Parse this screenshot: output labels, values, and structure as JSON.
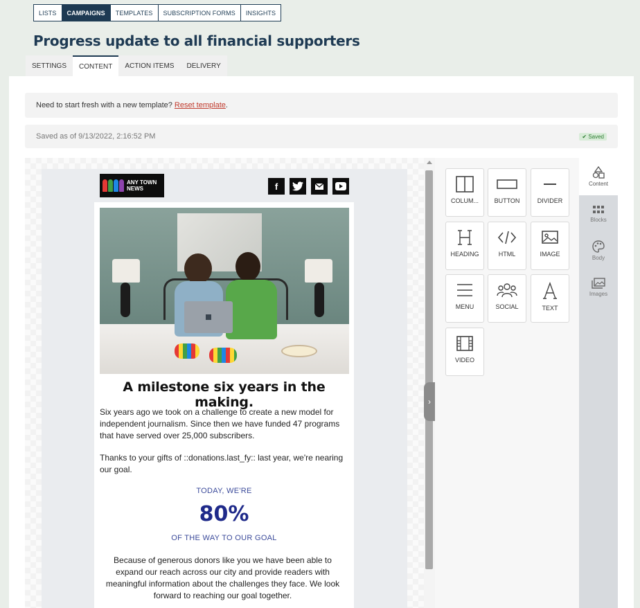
{
  "nav": {
    "items": [
      {
        "label": "LISTS",
        "active": false
      },
      {
        "label": "CAMPAIGNS",
        "active": true
      },
      {
        "label": "TEMPLATES",
        "active": false
      },
      {
        "label": "SUBSCRIPTION FORMS",
        "active": false
      },
      {
        "label": "INSIGHTS",
        "active": false
      }
    ]
  },
  "page": {
    "title": "Progress update to all financial supporters"
  },
  "tabs": [
    {
      "label": "SETTINGS",
      "active": false
    },
    {
      "label": "CONTENT",
      "active": true
    },
    {
      "label": "ACTION ITEMS",
      "active": false
    },
    {
      "label": "DELIVERY",
      "active": false
    }
  ],
  "notice": {
    "text": "Need to start fresh with a new template?",
    "link": "Reset template",
    "after": "."
  },
  "saved": {
    "text": "Saved as of 9/13/2022, 2:16:52 PM",
    "badge": "Saved"
  },
  "email": {
    "logo_text": "ANY TOWN\nNEWS",
    "social_icons": [
      "facebook-icon",
      "twitter-icon",
      "email-icon",
      "youtube-icon"
    ],
    "heading": "A milestone six years in the making.",
    "paragraph1": "Six years ago we took on a challenge to create a new model for independent journalism. Since then we have funded 47 programs that have served over 25,000 subscribers.",
    "paragraph2": "Thanks to your gifts of ::donations.last_fy:: last year, we're nearing our goal.",
    "stat_top": "TODAY, WE'RE",
    "stat_value": "80%",
    "stat_bottom": "OF THE WAY TO OUR GOAL",
    "paragraph3": "Because of generous donors like you we have been able to expand our reach across our city and provide readers with meaningful information about the challenges they face. We look forward to reaching our goal together."
  },
  "tools": [
    {
      "label": "COLUM...",
      "icon": "columns-icon"
    },
    {
      "label": "BUTTON",
      "icon": "button-icon"
    },
    {
      "label": "DIVIDER",
      "icon": "divider-icon"
    },
    {
      "label": "HEADING",
      "icon": "heading-icon"
    },
    {
      "label": "HTML",
      "icon": "html-icon"
    },
    {
      "label": "IMAGE",
      "icon": "image-icon"
    },
    {
      "label": "MENU",
      "icon": "menu-icon"
    },
    {
      "label": "SOCIAL",
      "icon": "social-icon"
    },
    {
      "label": "TEXT",
      "icon": "text-icon"
    },
    {
      "label": "VIDEO",
      "icon": "video-icon"
    }
  ],
  "side_tabs": [
    {
      "label": "Content",
      "icon": "shapes-icon",
      "active": true
    },
    {
      "label": "Blocks",
      "icon": "blocks-icon",
      "active": false
    },
    {
      "label": "Body",
      "icon": "palette-icon",
      "active": false
    },
    {
      "label": "Images",
      "icon": "images-icon",
      "active": false
    }
  ],
  "colors": {
    "brand_dark": "#1e3a53",
    "reset_link": "#c0392b",
    "stat_blue": "#1f2a8a",
    "saved_green": "#2e7d32"
  }
}
